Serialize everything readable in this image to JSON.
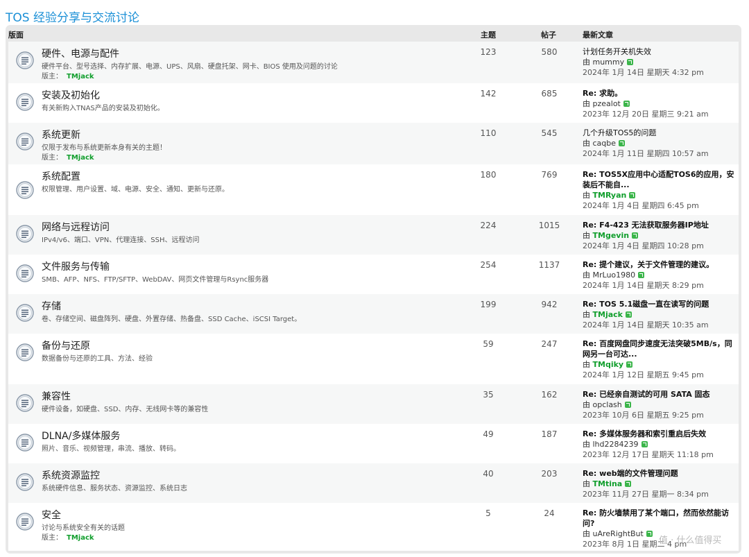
{
  "page_title": "TOS 经验分享与交流讨论",
  "header": {
    "forum": "版面",
    "topics": "主题",
    "posts": "帖子",
    "last_post": "最新文章"
  },
  "moderator_label": "版主：",
  "by_label": "由",
  "watermark": "值 · 什么值得买",
  "forums": [
    {
      "name": "硬件、电源与配件",
      "desc": "硬件平台、型号选择、内存扩展、电源、UPS、风扇、硬盘托架、网卡、BIOS 使用及问题的讨论",
      "moderator": "TMjack",
      "topics": "123",
      "posts": "580",
      "last_title": "计划任务开关机失效",
      "last_bold": false,
      "last_user": "mummy",
      "last_user_green": false,
      "last_date": "2024年 1月 14日 星期天 4:32 pm"
    },
    {
      "name": "安装及初始化",
      "desc": "有关新购入TNAS产品的安装及初始化。",
      "moderator": "",
      "topics": "142",
      "posts": "685",
      "last_title": "Re: 求助。",
      "last_bold": true,
      "last_user": "pzealot",
      "last_user_green": false,
      "last_date": "2023年 12月 20日 星期三 9:21 am"
    },
    {
      "name": "系统更新",
      "desc": "仅限于发布与系统更新本身有关的主题！",
      "moderator": "TMjack",
      "topics": "110",
      "posts": "545",
      "last_title": "几个升级TOS5的问题",
      "last_bold": false,
      "last_user": "caqbe",
      "last_user_green": false,
      "last_date": "2024年 1月 11日 星期四 10:57 am"
    },
    {
      "name": "系统配置",
      "desc": "权限管理、用户设置、域、电源、安全、通知、更新与还原。",
      "moderator": "",
      "topics": "180",
      "posts": "769",
      "last_title": "Re: TOS5X应用中心适配TOS6的应用，安装后不能自...",
      "last_bold": true,
      "last_user": "TMRyan",
      "last_user_green": true,
      "last_date": "2024年 1月 4日 星期四 6:45 pm"
    },
    {
      "name": "网络与远程访问",
      "desc": "IPv4/v6、端口、VPN、代理连接、SSH、远程访问",
      "moderator": "",
      "topics": "224",
      "posts": "1015",
      "last_title": "Re: F4-423 无法获取服务器IP地址",
      "last_bold": true,
      "last_user": "TMgevin",
      "last_user_green": true,
      "last_date": "2024年 1月 4日 星期四 10:28 pm"
    },
    {
      "name": "文件服务与传输",
      "desc": "SMB、AFP、NFS、FTP/SFTP、WebDAV、网页文件管理与Rsync服务器",
      "moderator": "",
      "topics": "254",
      "posts": "1137",
      "last_title": "Re: 提个建议，关于文件管理的建议。",
      "last_bold": true,
      "last_user": "MrLuo1980",
      "last_user_green": false,
      "last_date": "2024年 1月 14日 星期天 8:29 pm"
    },
    {
      "name": "存储",
      "desc": "卷、存储空间、磁盘阵列、硬盘、外置存储、热备盘、SSD Cache、iSCSI Target。",
      "moderator": "",
      "topics": "199",
      "posts": "942",
      "last_title": "Re: TOS 5.1磁盘一直在读写的问题",
      "last_bold": true,
      "last_user": "TMjack",
      "last_user_green": true,
      "last_date": "2024年 1月 14日 星期天 10:35 am"
    },
    {
      "name": "备份与还原",
      "desc": "数据备份与还原的工具、方法、经验",
      "moderator": "",
      "topics": "59",
      "posts": "247",
      "last_title": "Re: 百度网盘同步速度无法突破5MB/s，同网另一台可达...",
      "last_bold": true,
      "last_user": "TMqiky",
      "last_user_green": true,
      "last_date": "2024年 1月 12日 星期五 9:45 pm"
    },
    {
      "name": "兼容性",
      "desc": "硬件设备，如硬盘、SSD、内存、无线网卡等的兼容性",
      "moderator": "",
      "topics": "35",
      "posts": "162",
      "last_title": "Re: 已经亲自测试的可用 SATA 固态",
      "last_bold": true,
      "last_user": "opclash",
      "last_user_green": false,
      "last_date": "2023年 10月 6日 星期五 9:25 pm"
    },
    {
      "name": "DLNA/多媒体服务",
      "desc": "照片、音乐、视频管理，串流、播放、转码。",
      "moderator": "",
      "topics": "49",
      "posts": "187",
      "last_title": "Re: 多媒体服务器和索引重启后失效",
      "last_bold": true,
      "last_user": "lhd2284239",
      "last_user_green": false,
      "last_date": "2023年 12月 17日 星期天 11:18 pm"
    },
    {
      "name": "系统资源监控",
      "desc": "系统硬件信息、服务状态、资源监控、系统日志",
      "moderator": "",
      "topics": "40",
      "posts": "203",
      "last_title": "Re: web端的文件管理问题",
      "last_bold": true,
      "last_user": "TMtina",
      "last_user_green": true,
      "last_date": "2023年 11月 27日 星期一 8:34 pm"
    },
    {
      "name": "安全",
      "desc": "讨论与系统安全有关的话题",
      "moderator": "TMjack",
      "topics": "5",
      "posts": "24",
      "last_title": "Re: 防火墙禁用了某个端口，然而依然能访问?",
      "last_bold": true,
      "last_user": "uAreRightBut",
      "last_user_green": false,
      "last_date": "2023年 8月 1日 星期二 4 pm"
    }
  ]
}
